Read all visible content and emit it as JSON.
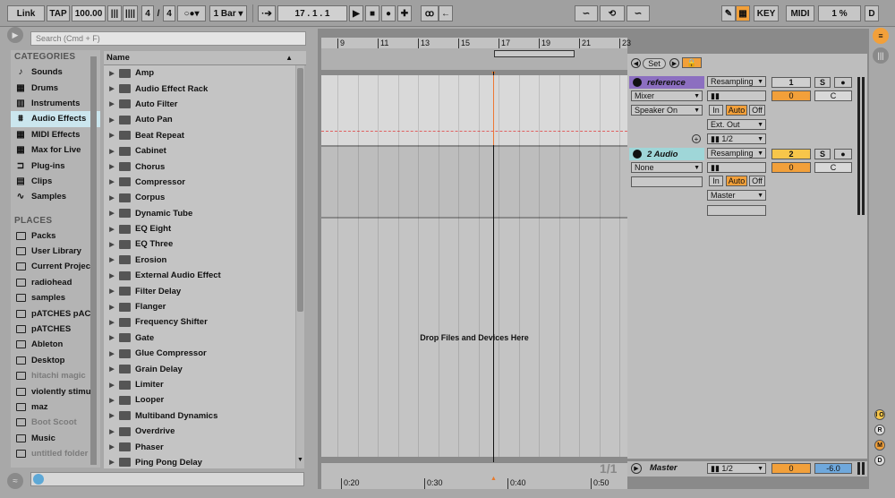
{
  "transport": {
    "link": "Link",
    "tap": "TAP",
    "tempo": "100.00",
    "sig_num": "4",
    "sig_slash": "/",
    "sig_den": "4",
    "quant": "1 Bar",
    "position": "17 .   1 .   1",
    "key": "KEY",
    "midi": "MIDI",
    "cpu": "1 %",
    "d": "D"
  },
  "browser": {
    "search_placeholder": "Search (Cmd + F)",
    "categories_title": "CATEGORIES",
    "categories": [
      {
        "label": "Sounds",
        "icon": "note-icon"
      },
      {
        "label": "Drums",
        "icon": "grid-icon"
      },
      {
        "label": "Instruments",
        "icon": "keyboard-icon"
      },
      {
        "label": "Audio Effects",
        "icon": "sliders-icon",
        "selected": true
      },
      {
        "label": "MIDI Effects",
        "icon": "grid-icon"
      },
      {
        "label": "Max for Live",
        "icon": "grid-icon"
      },
      {
        "label": "Plug-ins",
        "icon": "plug-icon"
      },
      {
        "label": "Clips",
        "icon": "clip-icon"
      },
      {
        "label": "Samples",
        "icon": "wave-icon"
      }
    ],
    "places_title": "PLACES",
    "places": [
      {
        "label": "Packs",
        "dim": false
      },
      {
        "label": "User Library",
        "dim": false
      },
      {
        "label": "Current Projec",
        "dim": false
      },
      {
        "label": "radiohead",
        "dim": false
      },
      {
        "label": "samples",
        "dim": false
      },
      {
        "label": "pATCHES pAC",
        "dim": false
      },
      {
        "label": "pATCHES",
        "dim": false
      },
      {
        "label": "Ableton",
        "dim": false
      },
      {
        "label": "Desktop",
        "dim": false
      },
      {
        "label": "hitachi magic",
        "dim": true
      },
      {
        "label": "violently stimu",
        "dim": false
      },
      {
        "label": "maz",
        "dim": false
      },
      {
        "label": "Boot Scoot",
        "dim": true
      },
      {
        "label": "Music",
        "dim": false
      },
      {
        "label": "untitled folder",
        "dim": true
      }
    ],
    "list_header": "Name",
    "items": [
      "Amp",
      "Audio Effect Rack",
      "Auto Filter",
      "Auto Pan",
      "Beat Repeat",
      "Cabinet",
      "Chorus",
      "Compressor",
      "Corpus",
      "Dynamic Tube",
      "EQ Eight",
      "EQ Three",
      "Erosion",
      "External Audio Effect",
      "Filter Delay",
      "Flanger",
      "Frequency Shifter",
      "Gate",
      "Glue Compressor",
      "Grain Delay",
      "Limiter",
      "Looper",
      "Multiband Dynamics",
      "Overdrive",
      "Phaser",
      "Ping Pong Delay"
    ]
  },
  "arrangement": {
    "ruler_ticks": [
      "9",
      "11",
      "13",
      "15",
      "17",
      "19",
      "21",
      "23"
    ],
    "time_ticks": [
      "0:20",
      "0:30",
      "0:40",
      "0:50"
    ],
    "drop_text": "Drop Files and Devices Here",
    "page": "1/1",
    "set_label": "Set"
  },
  "tracks": [
    {
      "name": "reference",
      "color": "#8c6fc0",
      "in_source": "Resampling",
      "monitor": "Mixer",
      "device": "Speaker On",
      "in": "In",
      "auto": "Auto",
      "off": "Off",
      "out": "Ext. Out",
      "out_ch": "1/2",
      "number": "1",
      "volume": "0",
      "pan": "C",
      "solo": "S"
    },
    {
      "name": "2 Audio",
      "color": "#9fd6d8",
      "in_source": "Resampling",
      "monitor": "None",
      "in": "In",
      "auto": "Auto",
      "off": "Off",
      "out": "Master",
      "number": "2",
      "volume": "0",
      "pan": "C",
      "solo": "S"
    }
  ],
  "master": {
    "name": "Master",
    "out_ch": "1/2",
    "volume": "0",
    "gain": "-6.0"
  },
  "right_buttons": [
    "I O",
    "R",
    "M",
    "D"
  ]
}
